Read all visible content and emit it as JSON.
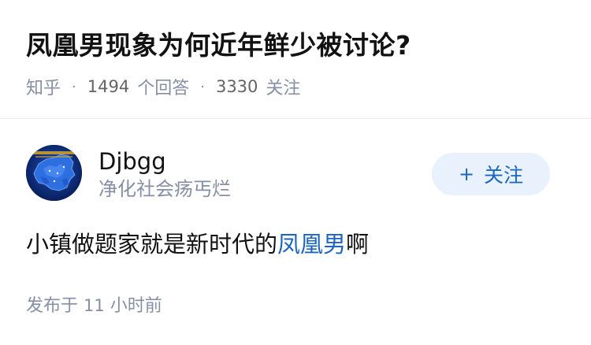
{
  "question": {
    "title": "凤凰男现象为何近年鲜少被讨论?",
    "source": "知乎",
    "answer_count": "1494",
    "answer_label": "个回答",
    "follower_count": "3330",
    "follower_label": "关注",
    "separator": "·"
  },
  "answer": {
    "author": {
      "name": "Djbgg",
      "headline": "净化社会疡丐烂",
      "avatar_icon": "china-map-avatar-icon"
    },
    "follow_button": {
      "plus": "+",
      "label": "关注"
    },
    "content": {
      "before": "小镇做题家就是新时代的",
      "keyword": "凤凰男",
      "after": "啊"
    },
    "published": {
      "label": "发布于",
      "value": "11",
      "unit": "小时前"
    }
  },
  "colors": {
    "link_blue": "#1a66c2",
    "button_bg": "#e8f1fc",
    "meta_gray": "#8590a6",
    "text_dark": "#121212",
    "avatar_bg": "#0e2b7a"
  }
}
